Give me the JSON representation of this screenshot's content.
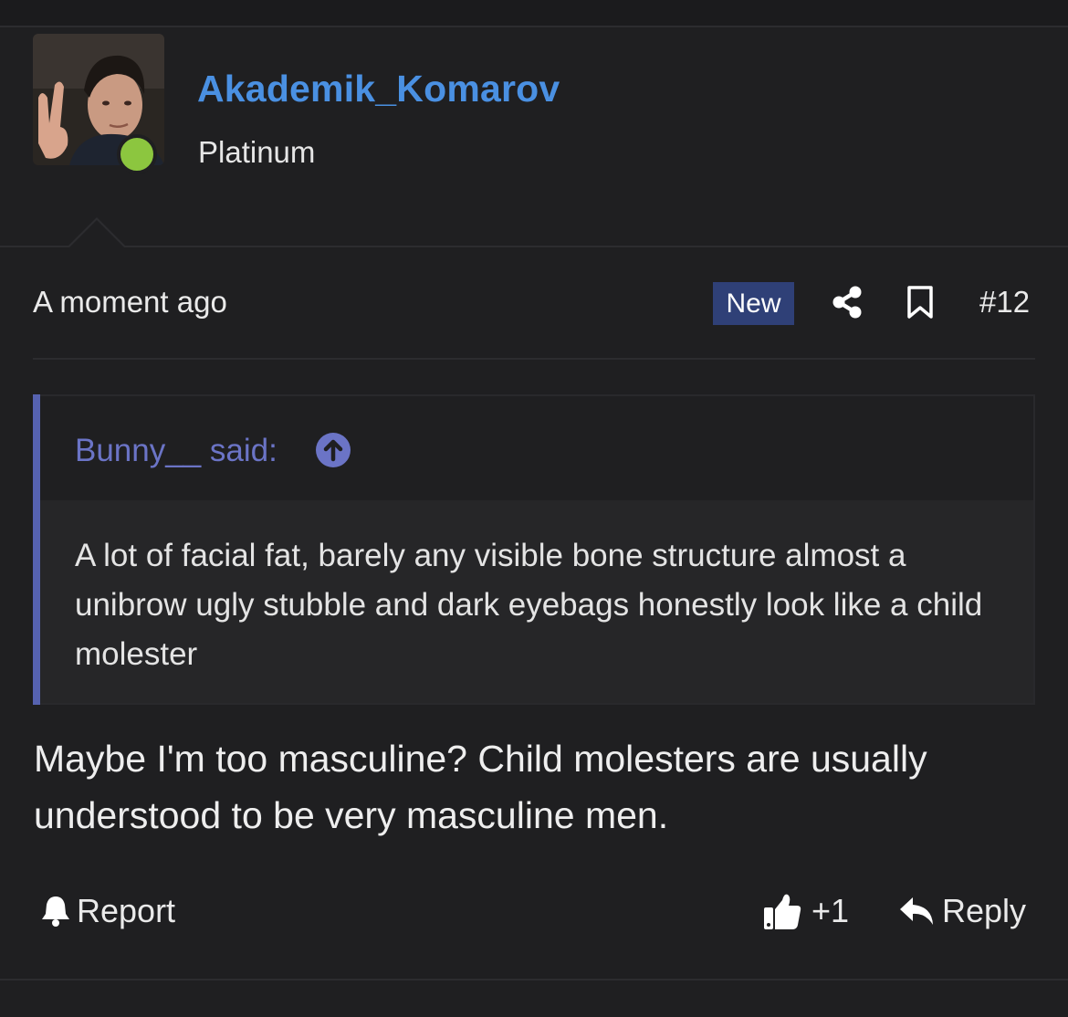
{
  "post": {
    "author": {
      "username": "Akademik_Komarov",
      "title": "Platinum",
      "online": true,
      "online_color": "#8cc63f",
      "username_color": "#4a90e2"
    },
    "meta": {
      "timestamp": "A moment ago",
      "badge": "New",
      "badge_color": "#2f4077",
      "share_icon": "share-icon",
      "bookmark_icon": "bookmark-icon",
      "post_number": "#12"
    },
    "quote": {
      "author_line": "Bunny__ said:",
      "jump_icon": "arrow-up-circle-icon",
      "accent_color": "#5662b0",
      "text": "A lot of facial fat, barely any visible bone structure almost a unibrow ugly stubble and dark eyebags honestly look like a child molester"
    },
    "body": "Maybe I'm too masculine? Child molesters are usually understood to be very masculine men.",
    "actions": {
      "report_label": "Report",
      "report_icon": "bell-icon",
      "like_count": "+1",
      "like_icon": "thumbs-up-icon",
      "reply_label": "Reply",
      "reply_icon": "reply-arrow-icon"
    }
  }
}
